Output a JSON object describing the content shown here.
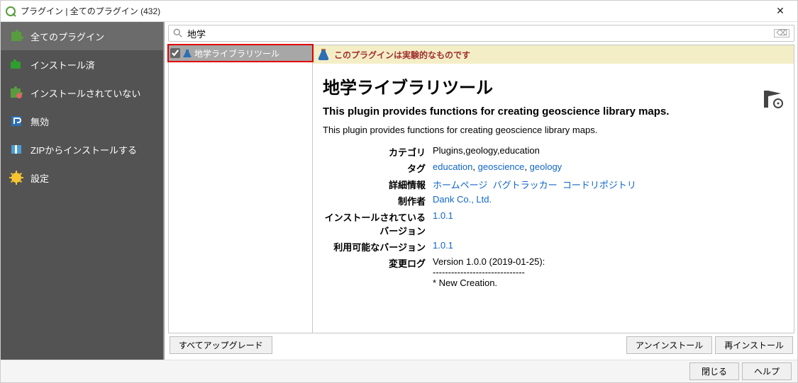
{
  "window": {
    "title": "プラグイン | 全てのプラグイン (432)"
  },
  "search": {
    "query": "地学"
  },
  "sidebar": {
    "items": [
      {
        "label": "全てのプラグイン"
      },
      {
        "label": "インストール済"
      },
      {
        "label": "インストールされていない"
      },
      {
        "label": "無効"
      },
      {
        "label": "ZIPからインストールする"
      },
      {
        "label": "設定"
      }
    ]
  },
  "list": {
    "items": [
      {
        "label": "地学ライブラリツール",
        "checked": true
      }
    ]
  },
  "detail": {
    "warning": "このプラグインは実験的なものです",
    "title": "地学ライブラリツール",
    "subtitle": "This plugin provides functions for creating geoscience library maps.",
    "description": "This plugin provides functions for creating geoscience library maps.",
    "meta": {
      "category_label": "カテゴリ",
      "category_value": "Plugins,geology,education",
      "tag_label": "タグ",
      "tag_links": {
        "education": "education",
        "geoscience": "geoscience",
        "geology": "geology"
      },
      "moreinfo_label": "詳細情報",
      "moreinfo_links": {
        "homepage": "ホームページ",
        "bugtracker": "バグトラッカー",
        "coderepo": "コードリポジトリ"
      },
      "author_label": "制作者",
      "author_value": "Dank Co., Ltd.",
      "installed_ver_label": "インストールされているバージョン",
      "installed_ver_value": "1.0.1",
      "avail_ver_label": "利用可能なバージョン",
      "avail_ver_value": "1.0.1",
      "changelog_label": "変更ログ",
      "changelog_line1": "Version 1.0.0 (2019-01-25):",
      "changelog_line2": "------------------------------",
      "changelog_line3": "* New Creation."
    }
  },
  "buttons": {
    "upgrade_all": "すべてアップグレード",
    "uninstall": "アンインストール",
    "reinstall": "再インストール",
    "close": "閉じる",
    "help": "ヘルプ"
  },
  "icons": {
    "puzzle_green": "#589c3e",
    "puzzle_ext": "#2e9e2e",
    "flask_color": "#2d6fb5"
  }
}
